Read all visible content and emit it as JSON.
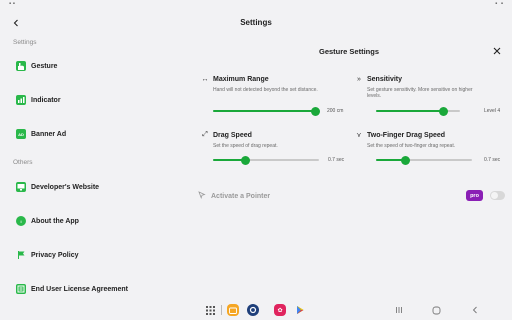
{
  "header": {
    "title": "Settings"
  },
  "sidebar": {
    "sections": [
      {
        "header": "Settings",
        "items": [
          {
            "label": "Gesture",
            "icon": "gesture-icon"
          },
          {
            "label": "Indicator",
            "icon": "indicator-icon"
          },
          {
            "label": "Banner Ad",
            "icon": "ad-icon"
          }
        ]
      },
      {
        "header": "Others",
        "items": [
          {
            "label": "Developer's Website",
            "icon": "monitor-icon"
          },
          {
            "label": "About the App",
            "icon": "info-icon"
          },
          {
            "label": "Privacy Policy",
            "icon": "flag-icon"
          },
          {
            "label": "End User License Agreement",
            "icon": "license-icon"
          }
        ]
      }
    ]
  },
  "panel": {
    "title": "Gesture Settings",
    "settings": [
      {
        "title": "Maximum Range",
        "desc": "Hand will not detected beyond the set distance.",
        "value_label": "200 cm",
        "fraction": 0.96,
        "icon": "horizontal-arrows-icon"
      },
      {
        "title": "Sensitivity",
        "desc": "Set gesture sensitivity. More sensitive on higher levels.",
        "value_label": "Level 4",
        "fraction": 0.8,
        "icon": "double-chevron-icon"
      },
      {
        "title": "Drag Speed",
        "desc": "Set the speed of drag repeat.",
        "value_label": "0.7 sec",
        "fraction": 0.3,
        "icon": "diagonal-arrows-icon"
      },
      {
        "title": "Two-Finger Drag Speed",
        "desc": "Set the speed of two-finger drag repeat.",
        "value_label": "0.7 sec",
        "fraction": 0.3,
        "icon": "double-chevron-down-icon"
      }
    ],
    "pointer": {
      "label": "Activate a Pointer",
      "badge": "pro",
      "enabled": false
    }
  },
  "colors": {
    "accent": "#1aa83a",
    "pro": "#8a1fb5",
    "background": "#f2f2f4"
  }
}
